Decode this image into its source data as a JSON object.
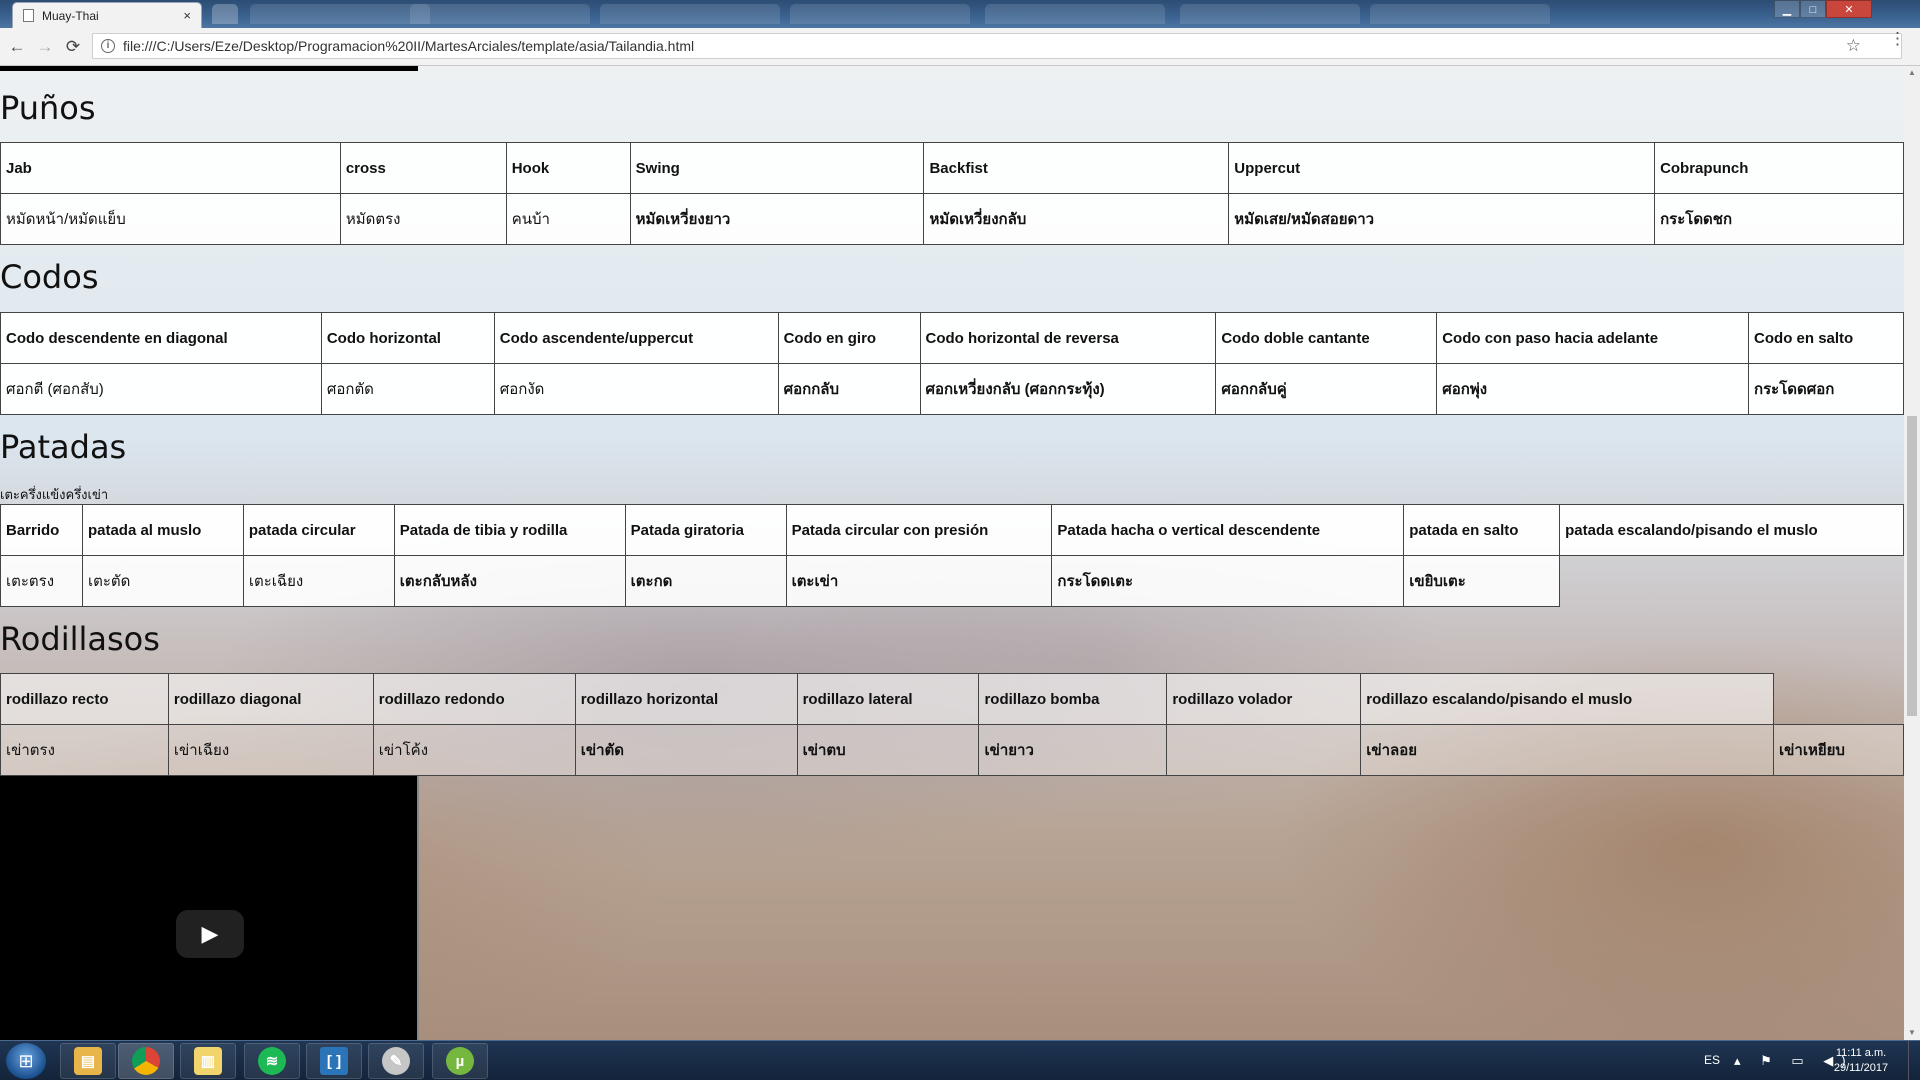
{
  "browser": {
    "tab_title": "Muay-Thai",
    "tab_close": "×",
    "url": "file:///C:/Users/Eze/Desktop/Programacion%20II/MartesArciales/template/asia/Tailandia.html",
    "back": "←",
    "forward": "→",
    "reload": "⟳",
    "info": "i",
    "star": "☆",
    "menu": "⋮",
    "win_min": "▁",
    "win_max": "□",
    "win_close": "✕"
  },
  "sections": {
    "punos": {
      "title": "Puños",
      "headers": [
        "Jab",
        "cross",
        "Hook",
        "Swing",
        "Backfist",
        "Uppercut",
        "Cobrapunch"
      ],
      "values": [
        "หมัดหน้า/หมัดแย็บ",
        "หมัดตรง",
        "คนบ้า",
        "หมัดเหวี่ยงยาว",
        "หมัดเหวี่ยงกลับ",
        "หมัดเสย/หมัดสอยดาว",
        "กระโดดชก"
      ]
    },
    "codos": {
      "title": "Codos",
      "headers": [
        "Codo descendente en diagonal",
        "Codo horizontal",
        "Codo ascendente/uppercut",
        "Codo en giro",
        "Codo horizontal de reversa",
        "Codo doble cantante",
        "Codo con paso hacia adelante",
        "Codo en salto"
      ],
      "values": [
        "ศอกตี (ศอกสับ)",
        "ศอกตัด",
        "ศอกงัด",
        "ศอกกลับ",
        "ศอกเหวี่ยงกลับ (ศอกกระทุ้ง)",
        "ศอกกลับคู่",
        "ศอกพุ่ง",
        "กระโดดศอก"
      ]
    },
    "patadas": {
      "title": "Patadas",
      "note": "เตะครึ่งแข้งครึ่งเข่า",
      "headers": [
        "Barrido",
        "patada al muslo",
        "patada circular",
        "Patada de tibia y rodilla",
        "Patada giratoria",
        "Patada circular con presión",
        "Patada hacha o vertical descendente",
        "patada en salto",
        "patada escalando/pisando el muslo"
      ],
      "values": [
        "เตะตรง",
        "เตะตัด",
        "เตะเฉียง",
        "เตะกลับหลัง",
        "เตะกด",
        "เตะเข่า",
        "กระโดดเตะ",
        "เขยิบเตะ"
      ]
    },
    "rodillasos": {
      "title": "Rodillasos",
      "headers": [
        "rodillazo recto",
        "rodillazo diagonal",
        "rodillazo redondo",
        "rodillazo horizontal",
        "rodillazo lateral",
        "rodillazo bomba",
        "rodillazo volador",
        "rodillazo escalando/pisando el muslo"
      ],
      "values": [
        "เข่าตรง",
        "เข่าเฉียง",
        "เข่าโค้ง",
        "เข่าตัด",
        "เข่าตบ",
        "เข่ายาว",
        "",
        "เข่าลอย",
        "เข่าเหยียบ"
      ]
    }
  },
  "video": {
    "play": "▶"
  },
  "scrollbar": {
    "up": "▲",
    "down": "▼"
  },
  "taskbar": {
    "start": "⊞",
    "apps": {
      "explorer": "▤",
      "chrome": "",
      "folder": "▥",
      "spotify": "≋",
      "brackets": "[ ]",
      "paint": "✎",
      "utorrent": "µ"
    },
    "lang": "ES",
    "tray": "▴ ⚑ ▭ ◀)",
    "time": "11:11 a.m.",
    "date": "29/11/2017"
  }
}
